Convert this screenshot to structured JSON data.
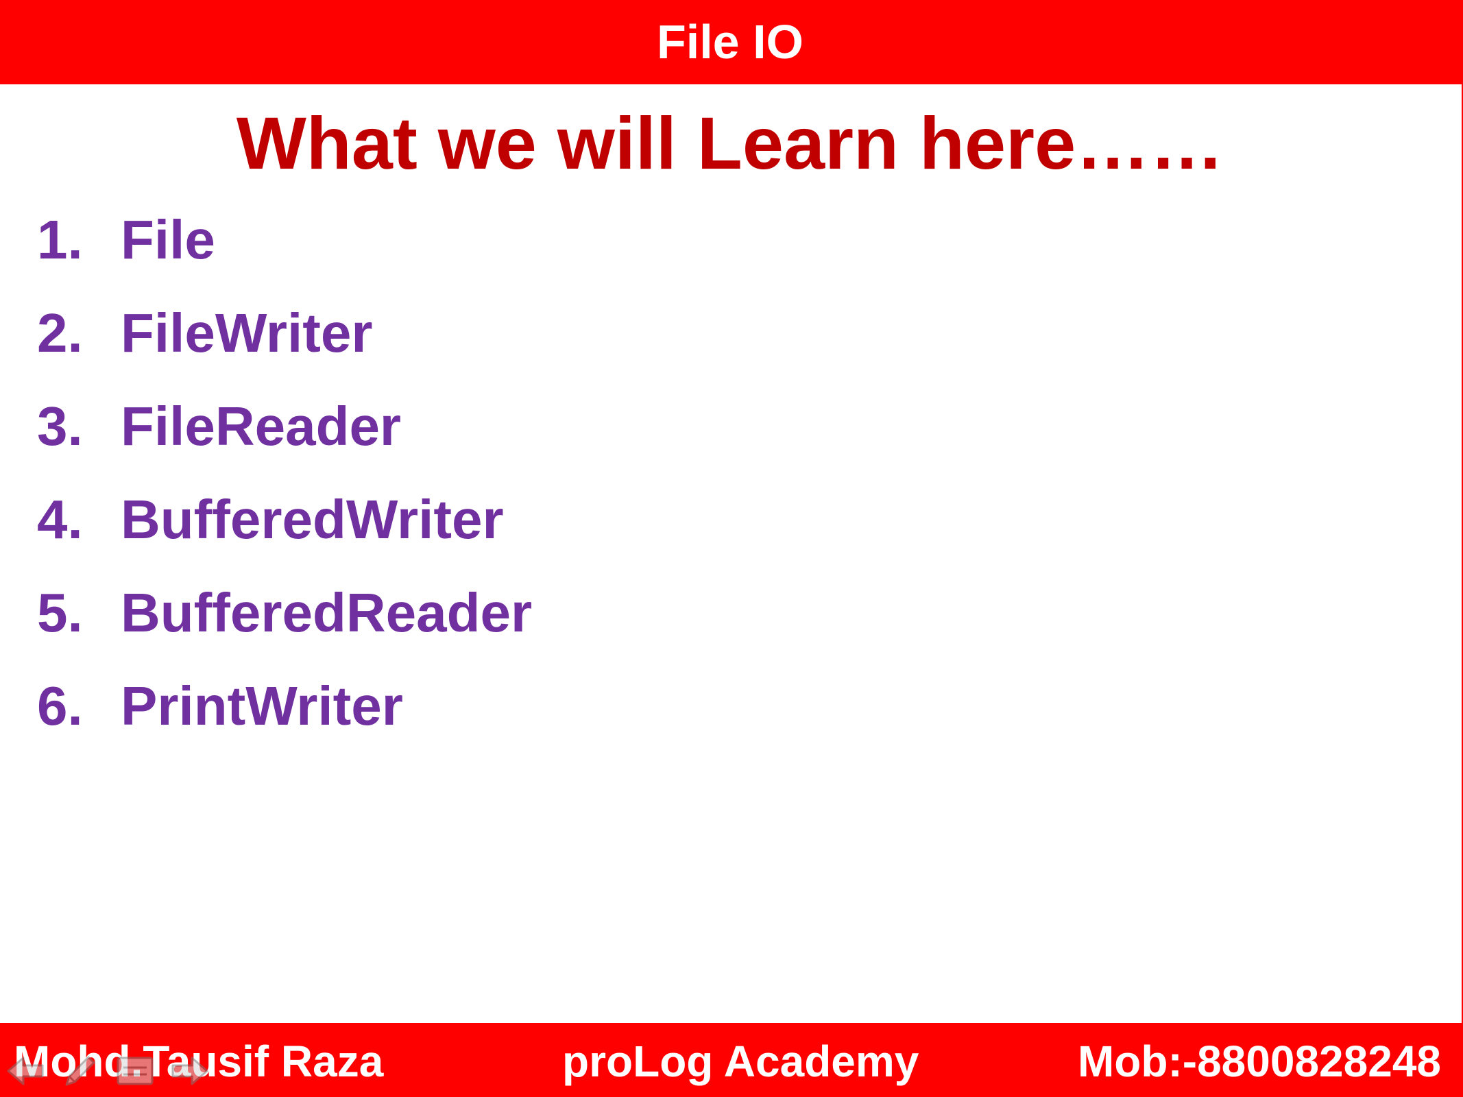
{
  "header": {
    "title": "File IO"
  },
  "slide": {
    "heading": "What we will Learn here……",
    "topics": [
      {
        "number": "1.",
        "label": "File"
      },
      {
        "number": "2.",
        "label": "FileWriter"
      },
      {
        "number": "3.",
        "label": "FileReader"
      },
      {
        "number": "4.",
        "label": "BufferedWriter"
      },
      {
        "number": "5.",
        "label": "BufferedReader"
      },
      {
        "number": "6.",
        "label": "PrintWriter"
      }
    ]
  },
  "footer": {
    "author": "Mohd.Tausif Raza",
    "academy": "proLog Academy",
    "phone": "Mob:-8800828248"
  },
  "controls": {
    "icons": [
      "previous-arrow-icon",
      "pen-icon",
      "slide-menu-icon",
      "next-arrow-icon"
    ]
  },
  "colors": {
    "bar": "#ff0000",
    "heading": "#c00000",
    "topics": "#7030a0",
    "bar_text": "#ffffff"
  }
}
